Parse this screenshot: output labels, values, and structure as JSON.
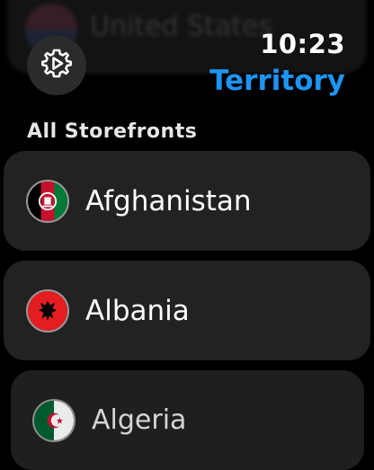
{
  "header": {
    "time": "10:23",
    "title": "Territory",
    "settings_icon": "gear-icon",
    "accent_color": "#1d95f5"
  },
  "ghost_row": {
    "label": "United States",
    "flag_icon": "us-flag-icon"
  },
  "list": {
    "section_header": "All Storefronts",
    "items": [
      {
        "label": "Afghanistan",
        "flag_icon": "afghanistan-flag-icon"
      },
      {
        "label": "Albania",
        "flag_icon": "albania-flag-icon"
      },
      {
        "label": "Algeria",
        "flag_icon": "algeria-flag-icon"
      }
    ]
  }
}
